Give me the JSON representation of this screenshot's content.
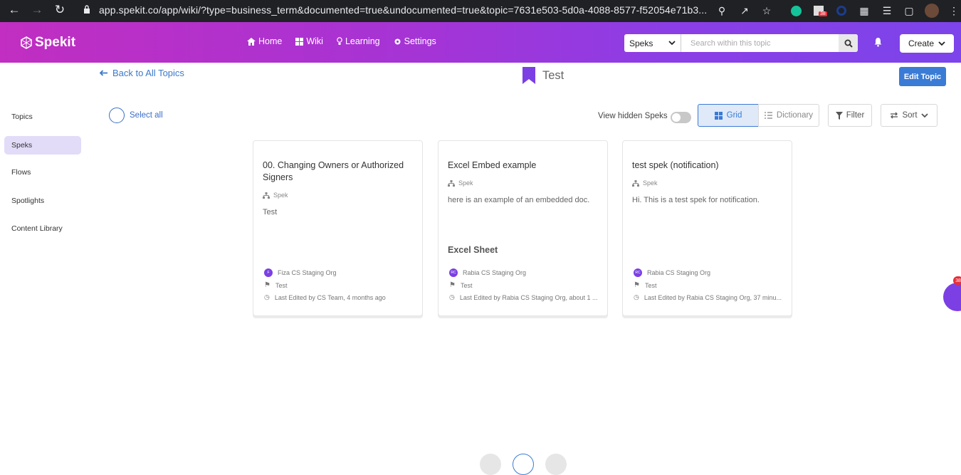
{
  "browser": {
    "url": "app.spekit.co/app/wiki/?type=business_term&documented=true&undocumented=true&topic=7631e503-5d0a-4088-8577-f52054e71b3...",
    "extension_badge": "38"
  },
  "header": {
    "logo_text": "Spekit",
    "nav": [
      {
        "label": "Home",
        "icon": "home-icon"
      },
      {
        "label": "Wiki",
        "icon": "grid-icon"
      },
      {
        "label": "Learning",
        "icon": "lightbulb-icon"
      },
      {
        "label": "Settings",
        "icon": "gear-icon"
      }
    ],
    "search_select": "Speks",
    "search_placeholder": "Search within this topic",
    "create_label": "Create"
  },
  "sidebar": {
    "items": [
      {
        "label": "Topics",
        "active": false
      },
      {
        "label": "Speks",
        "active": true
      },
      {
        "label": "Flows",
        "active": false
      },
      {
        "label": "Spotlights",
        "active": false
      },
      {
        "label": "Content Library",
        "active": false
      }
    ]
  },
  "topic": {
    "back_label": "Back to All Topics",
    "title": "Test",
    "edit_label": "Edit Topic"
  },
  "toolbar": {
    "select_all": "Select all",
    "view_hidden": "View hidden Speks",
    "grid": "Grid",
    "dictionary": "Dictionary",
    "filter": "Filter",
    "sort": "Sort"
  },
  "cards": [
    {
      "title": "00. Changing Owners or Authorized Signers",
      "type": "Spek",
      "body": "Test",
      "extra": "",
      "author": "Fiza CS Staging Org",
      "avatar": "F",
      "tag": "Test",
      "edited": "Last Edited by CS Team, 4 months ago"
    },
    {
      "title": "Excel Embed example",
      "type": "Spek",
      "body": "here is an example of an embedded doc.",
      "extra": "Excel Sheet",
      "author": "Rabia CS Staging Org",
      "avatar": "RC",
      "tag": "Test",
      "edited": "Last Edited by Rabia CS Staging Org, about 1 ..."
    },
    {
      "title": "test spek (notification)",
      "type": "Spek",
      "body": "Hi. This is a test spek for notification.",
      "extra": "",
      "author": "Rabia CS Staging Org",
      "avatar": "RC",
      "tag": "Test",
      "edited": "Last Edited by Rabia CS Staging Org, 37 minu..."
    }
  ],
  "widget_badge": "38",
  "colors": {
    "header_start": "#c12ec1",
    "header_end": "#7c44ea",
    "accent_blue": "#3a7bd5",
    "active_side": "#e2dcf8"
  }
}
